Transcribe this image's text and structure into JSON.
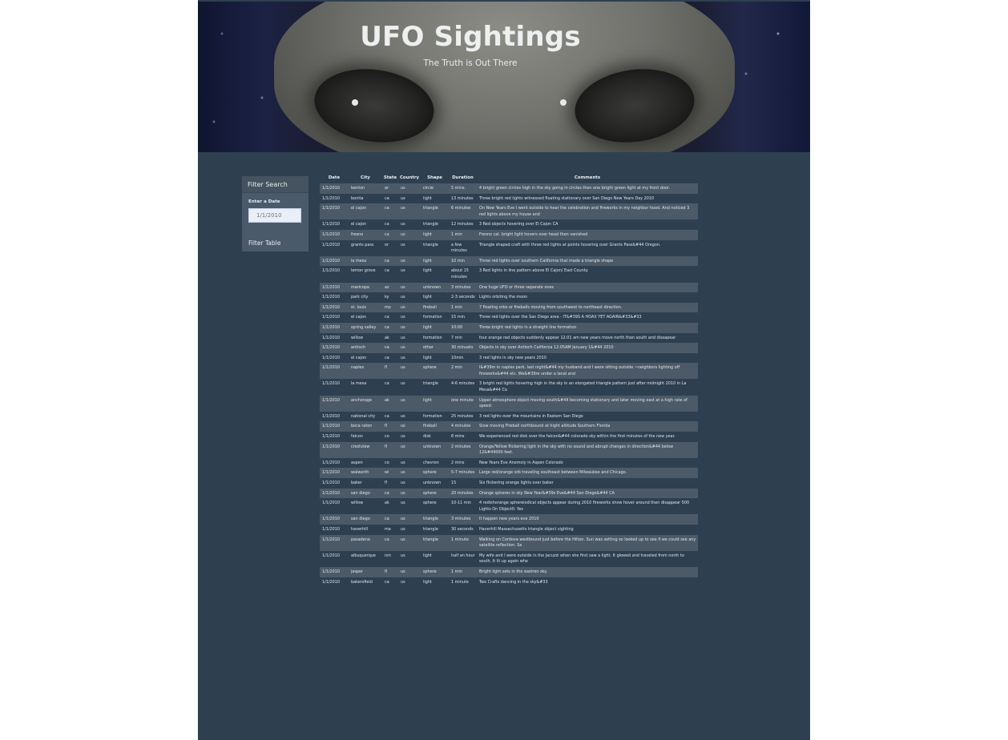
{
  "header": {
    "title": "UFO Sightings",
    "subtitle": "The Truth is Out There"
  },
  "filter": {
    "heading": "Filter Search",
    "date_label": "Enter a Date",
    "date_placeholder": "1/1/2010",
    "button_label": "Filter Table"
  },
  "table": {
    "columns": [
      "Date",
      "City",
      "State",
      "Country",
      "Shape",
      "Duration",
      "Comments"
    ],
    "rows": [
      [
        "1/1/2010",
        "benton",
        "ar",
        "us",
        "circle",
        "5 mins.",
        "4 bright green circles high in the sky going in circles then one bright green light at my front door."
      ],
      [
        "1/1/2010",
        "bonita",
        "ca",
        "us",
        "light",
        "13 minutes",
        "Three bright red lights witnessed floating stationary over San Diego New Years Day 2010"
      ],
      [
        "1/1/2010",
        "el cajon",
        "ca",
        "us",
        "triangle",
        "6 minutes",
        "On New Years Eve I went outside to hear the celebration and fireworks in my neighbor hood. And noticed 3 red lights above my house and"
      ],
      [
        "1/1/2010",
        "el cajon",
        "ca",
        "us",
        "triangle",
        "12 minutes",
        "3 Red objects hovering over El Cajon CA"
      ],
      [
        "1/1/2010",
        "fresno",
        "ca",
        "us",
        "light",
        "1 min",
        "Fresno cal. bright light hovers over head then vanished"
      ],
      [
        "1/1/2010",
        "grants pass",
        "or",
        "us",
        "triangle",
        "a few minutes",
        "Triangle shaped craft with three red lights at points hovering over Grants Pass&#44 Oregon."
      ],
      [
        "1/1/2010",
        "la mesa",
        "ca",
        "us",
        "light",
        "10 min",
        "Three red lights over southern California that made a triangle shape"
      ],
      [
        "1/1/2010",
        "lemon grove",
        "ca",
        "us",
        "light",
        "about 15 minutes",
        "3 Red lights in line pattern above El Cajon/ East County."
      ],
      [
        "1/1/2010",
        "maricopa",
        "az",
        "us",
        "unknown",
        "3 minutes",
        "One huge UFO or three separate ones"
      ],
      [
        "1/1/2010",
        "park city",
        "ky",
        "us",
        "light",
        "2-3 seconds",
        "Lights orbiting the moon"
      ],
      [
        "1/1/2010",
        "st. louis",
        "mo",
        "us",
        "fireball",
        "1 min",
        "7 floating orbs or fireballs moving from southwest to northeast direction."
      ],
      [
        "1/1/2010",
        "el cajon",
        "ca",
        "us",
        "formation",
        "15 min.",
        "Three red lights over the San Diego area - IT&#39S A HOAX YET AGAIN&#33&#33"
      ],
      [
        "1/1/2010",
        "spring valley",
        "ca",
        "us",
        "light",
        "10:00",
        "Three bright red lights in a straight line formation"
      ],
      [
        "1/1/2010",
        "willow",
        "ak",
        "us",
        "formation",
        "7 min",
        "four orange red objects suddenly appear 12:01 am new years move north then south and dissapear"
      ],
      [
        "1/1/2010",
        "antioch",
        "ca",
        "us",
        "other",
        "30 minuets",
        "Objects in sky over Antioch California 12:05AM January 1&#44 2010"
      ],
      [
        "1/1/2010",
        "el cajon",
        "ca",
        "us",
        "light",
        "10min",
        "3 red lights in sky new years 2010"
      ],
      [
        "1/1/2010",
        "naples",
        "fl",
        "us",
        "sphere",
        "2 min",
        "I&#39m in naples park. last night&#44 my husband and I were sitting outside ~neighbors lighting off fireworks&#44 etc. We&#39re under a lanai and"
      ],
      [
        "1/1/2010",
        "la mesa",
        "ca",
        "us",
        "triangle",
        "4-6 minutes",
        "3 bright red lights hovering high in the sky in an elongated triangle pattern just after midnight 2010 in La Mesa&#44 Ca"
      ],
      [
        "1/1/2010",
        "anchorage",
        "ak",
        "us",
        "light",
        "one minute",
        "Upper atmosphere object moving south&#44 becoming stationary and later moving east at a high rate of speed."
      ],
      [
        "1/1/2010",
        "national city",
        "ca",
        "us",
        "formation",
        "25 minutes",
        "3 red lights over the mountains in Eastern San Diego"
      ],
      [
        "1/1/2010",
        "boca raton",
        "fl",
        "us",
        "fireball",
        "4 minutes",
        "Slow moving Fireball northbound at hight altitude Southern Florida"
      ],
      [
        "1/1/2010",
        "falcon",
        "co",
        "us",
        "disk",
        "8 mins",
        "We experienced red disk over the falcon&#44 colorado sky within the first minutes of the new year."
      ],
      [
        "1/1/2010",
        "crestview",
        "fl",
        "us",
        "unknown",
        "2 minutes",
        "Orange/Yellow flickering light in the sky with no sound and abrupt changes in direction&#44 below 12&#44000 feet."
      ],
      [
        "1/1/2010",
        "aspen",
        "co",
        "us",
        "chevron",
        "2 mins",
        "New Years Eve Anomoly in Aspen Colorado"
      ],
      [
        "1/1/2010",
        "walworth",
        "wi",
        "us",
        "sphere",
        "5-7 minutes",
        "Large red/orange orb traveling southeast between Milwaukee and Chicago."
      ],
      [
        "1/1/2010",
        "baker",
        "fl",
        "us",
        "unknown",
        "15",
        "Six flickering orange lights over baker"
      ],
      [
        "1/1/2010",
        "san diego",
        "ca",
        "us",
        "sphere",
        "20 minutes",
        "Orange spheres in sky New Year&#39s Eve&#44 San Diego&#44 CA"
      ],
      [
        "1/1/2010",
        "willow",
        "ak",
        "us",
        "sphere",
        "10-11 min",
        "4 redishorange sphereiodical objects appear during 2010 fireworks show hover around then disappear 500 Lights On Object0: Yes"
      ],
      [
        "1/1/2010",
        "san diego",
        "ca",
        "us",
        "triangle",
        "3 minutes",
        "It happen new years eve 2010"
      ],
      [
        "1/1/2010",
        "haverhill",
        "ma",
        "us",
        "triangle",
        "30 seconds",
        "Haverhill Massachusetts triangle object sighting"
      ],
      [
        "1/1/2010",
        "pasadena",
        "ca",
        "us",
        "triangle",
        "1 minute",
        "Walking on Cordova westbound just before the Hilton. Sun was setting so looked up to see if we could see any satellite reflection. Sa"
      ],
      [
        "1/1/2010",
        "albuquerque",
        "nm",
        "us",
        "light",
        "half an hour",
        "My wife and I were outside in the Jacuzzi when she first saw a light. It glowed and traveled from north to south. It lit up again whe"
      ],
      [
        "1/1/2010",
        "jasper",
        "fl",
        "us",
        "sphere",
        "1 min",
        "Bright light sets in the eastren sky."
      ],
      [
        "1/1/2010",
        "bakersfield",
        "ca",
        "us",
        "light",
        "1 minute",
        "Two Crafts dancing in the sky&#33"
      ]
    ]
  }
}
